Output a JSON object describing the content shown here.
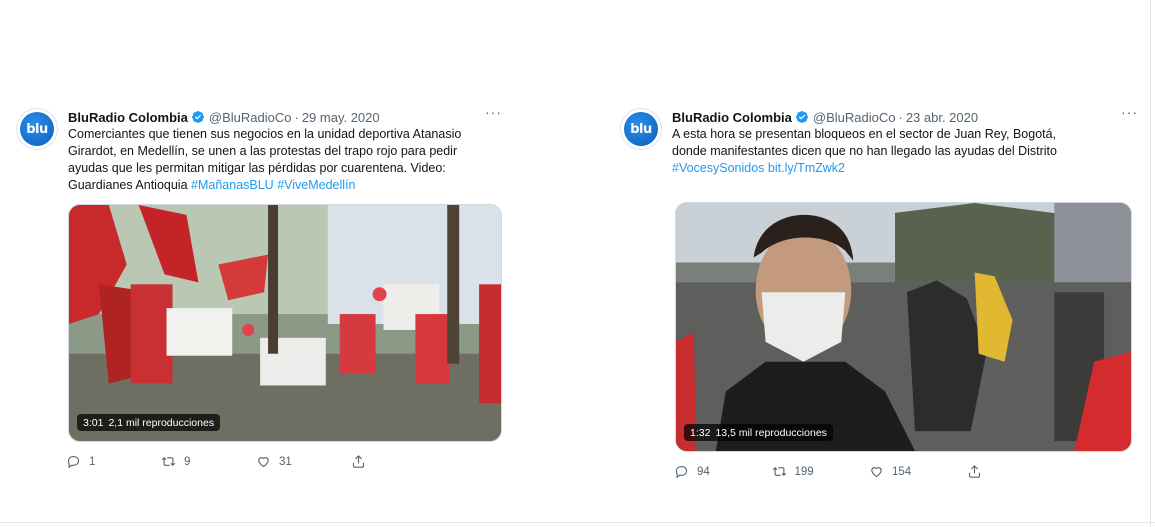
{
  "colors": {
    "link": "#1d9bf0",
    "muted": "#536471",
    "verified": "#1d9bf0"
  },
  "tweets": [
    {
      "avatar_text": "blu",
      "name": "BluRadio Colombia",
      "handle": "@BluRadioCo",
      "date": "29 may. 2020",
      "more": "···",
      "lines": [
        "Comerciantes que tienen sus negocios en la unidad deportiva Atanasio",
        "Girardot, en Medellín, se unen a las protestas del trapo rojo para pedir",
        "ayudas que les permitan mitigar las pérdidas por cuarentena. Video:"
      ],
      "last_line_prefix": "Guardianes Antioquia ",
      "hashtags": [
        "#MañanasBLU",
        "#ViveMedellín"
      ],
      "video": {
        "duration": "3:01",
        "views": "2,1 mil reproducciones"
      },
      "actions": {
        "replies": "1",
        "retweets": "9",
        "likes": "31"
      }
    },
    {
      "avatar_text": "blu",
      "name": "BluRadio Colombia",
      "handle": "@BluRadioCo",
      "date": "23 abr. 2020",
      "more": "···",
      "lines": [
        "A esta hora se presentan bloqueos en el sector de Juan Rey, Bogotá,",
        "donde manifestantes dicen que no han llegado las ayudas del Distrito"
      ],
      "last_line_prefix": "",
      "hashtags": [
        "#VocesySonidos",
        "bit.ly/TmZwk2"
      ],
      "video": {
        "duration": "1:32",
        "views": "13,5 mil reproducciones"
      },
      "actions": {
        "replies": "94",
        "retweets": "199",
        "likes": "154"
      }
    }
  ]
}
